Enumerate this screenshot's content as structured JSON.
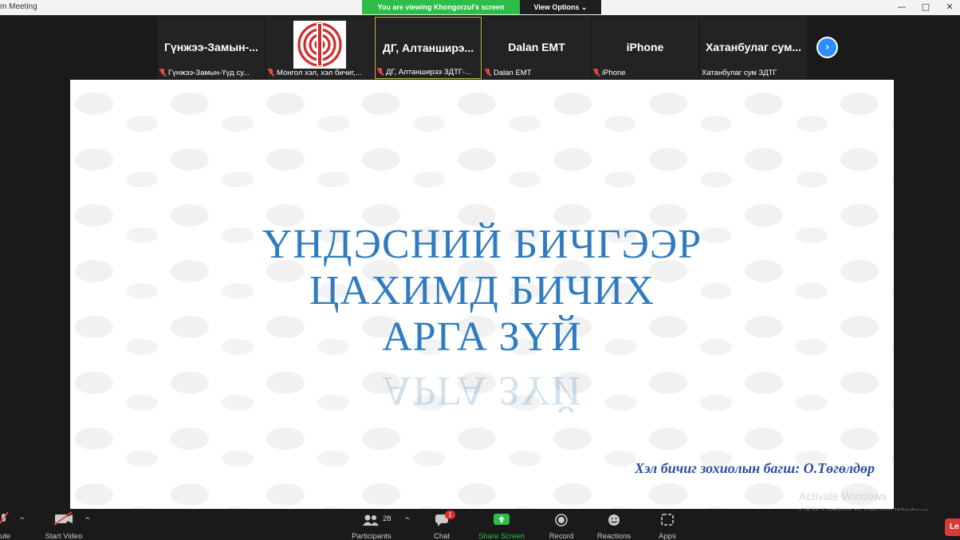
{
  "window": {
    "app_title": "m Meeting",
    "viewing_banner": "You are viewing Khongorzul's screen",
    "view_options": "View Options ⌄"
  },
  "participants": [
    {
      "name": "Гүнжээ-Замын-...",
      "label": "Гүнжээ-Замын-Үүд су...",
      "muted": true
    },
    {
      "name": "",
      "label": "Монгол хэл, хэл бичиг,...",
      "muted": true,
      "has_logo": true
    },
    {
      "name": "ДГ,  Алтанширэ...",
      "label": "ДГ, Алтанширээ ЗДТГ-...",
      "muted": true,
      "active": true
    },
    {
      "name": "Dalan EMT",
      "label": "Dalan EMT",
      "muted": true
    },
    {
      "name": "iPhone",
      "label": "iPhone",
      "muted": true
    },
    {
      "name": "Хатанбулаг  сум...",
      "label": "Хатанбулаг сум ЗДТГ",
      "muted": false
    }
  ],
  "next_page_icon": "›",
  "slide": {
    "title_lines": [
      "ҮНДЭСНИЙ БИЧГЭЭР",
      "ЦАХИМД БИЧИХ",
      "АРГА ЗҮЙ"
    ],
    "author": "Хэл бичиг зохиолын багш: О.Төгөлдөр",
    "title_color": "#2e7bbf",
    "author_color": "#2f4ea0"
  },
  "watermark": {
    "line1": "Activate Windows",
    "line2": "Go to Settings to activate Windows."
  },
  "toolbar": {
    "mute": "ute",
    "start_video": "Start Video",
    "participants": "Participants",
    "participants_count": "28",
    "chat": "Chat",
    "chat_badge": "1",
    "share_screen": "Share Screen",
    "record": "Record",
    "reactions": "Reactions",
    "apps": "Apps",
    "leave": "Le"
  },
  "colors": {
    "banner_green": "#2fbd49",
    "share_green": "#2fbd49",
    "accent_blue": "#2d8cff",
    "leave_red": "#d93b3b"
  }
}
